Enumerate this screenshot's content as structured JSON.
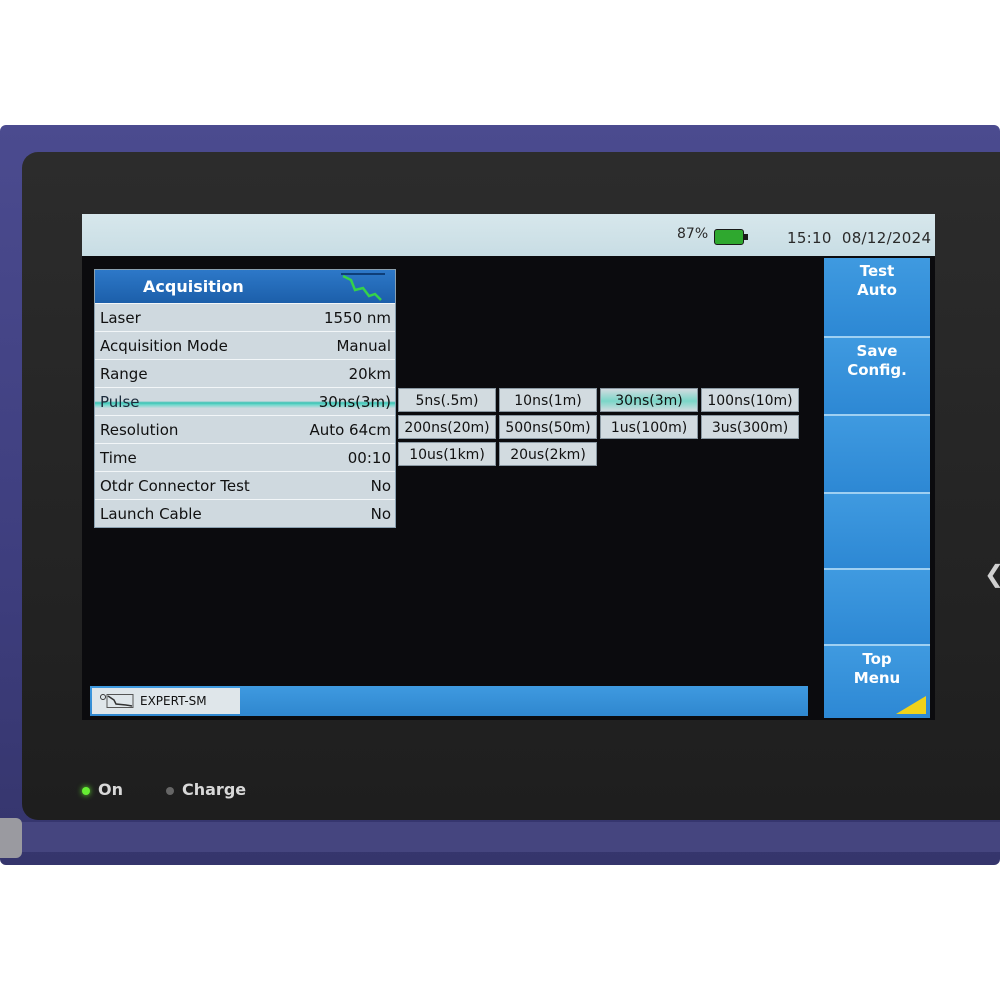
{
  "status_bar": {
    "battery_percent": "87%",
    "time": "15:10",
    "date": "08/12/2024"
  },
  "acquisition": {
    "title": "Acquisition",
    "rows": [
      {
        "label": "Laser",
        "value": "1550 nm"
      },
      {
        "label": "Acquisition Mode",
        "value": "Manual"
      },
      {
        "label": "Range",
        "value": "20km"
      },
      {
        "label": "Pulse",
        "value": "30ns(3m)"
      },
      {
        "label": "Resolution",
        "value": "Auto 64cm"
      },
      {
        "label": "Time",
        "value": "00:10"
      },
      {
        "label": "Otdr Connector Test",
        "value": "No"
      },
      {
        "label": "Launch Cable",
        "value": "No"
      }
    ]
  },
  "pulse_options": [
    "5ns(.5m)",
    "10ns(1m)",
    "30ns(3m)",
    "100ns(10m)",
    "200ns(20m)",
    "500ns(50m)",
    "1us(100m)",
    "3us(300m)",
    "10us(1km)",
    "20us(2km)"
  ],
  "pulse_selected": "30ns(3m)",
  "side_menu": {
    "test_auto": [
      "Test",
      "Auto"
    ],
    "save_config": [
      "Save",
      "Config."
    ],
    "top_menu": [
      "Top",
      "Menu"
    ]
  },
  "bottom_bar": {
    "mode_label": "EXPERT-SM"
  },
  "leds": {
    "on_label": "On",
    "charge_label": "Charge"
  },
  "colors": {
    "accent_blue": "#2d88d4",
    "selection_teal": "#39c3b4",
    "battery_green": "#2fa82f"
  }
}
